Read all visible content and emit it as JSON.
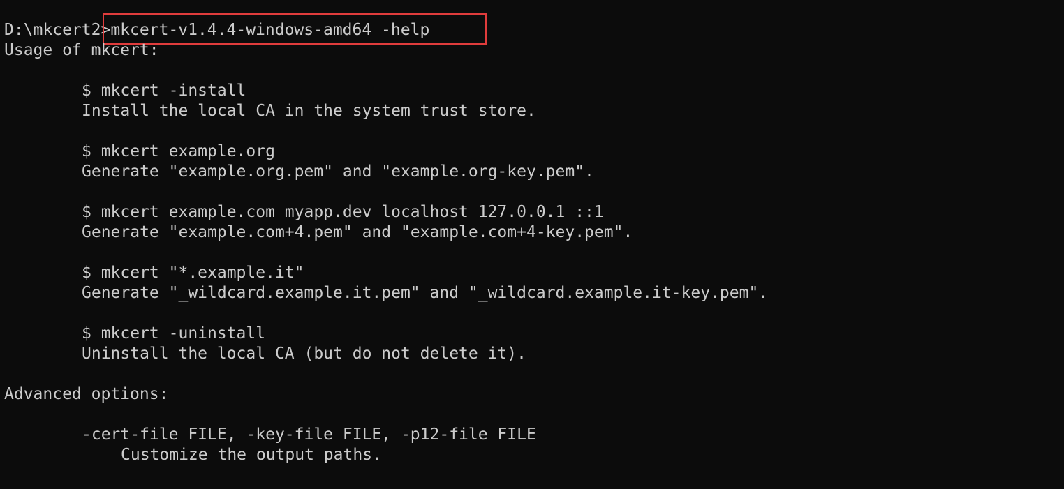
{
  "terminal": {
    "highlight_color": "#e03c3c",
    "background_color": "#0c0c0c",
    "text_color": "#cccccc",
    "prompt": "D:\\mkcert2>",
    "command": "mkcert-v1.4.4-windows-amd64 -help",
    "usage_header": "Usage of mkcert:",
    "examples": [
      {
        "cmd": "$ mkcert -install",
        "desc": "Install the local CA in the system trust store."
      },
      {
        "cmd": "$ mkcert example.org",
        "desc": "Generate \"example.org.pem\" and \"example.org-key.pem\"."
      },
      {
        "cmd": "$ mkcert example.com myapp.dev localhost 127.0.0.1 ::1",
        "desc": "Generate \"example.com+4.pem\" and \"example.com+4-key.pem\"."
      },
      {
        "cmd": "$ mkcert \"*.example.it\"",
        "desc": "Generate \"_wildcard.example.it.pem\" and \"_wildcard.example.it-key.pem\"."
      },
      {
        "cmd": "$ mkcert -uninstall",
        "desc": "Uninstall the local CA (but do not delete it)."
      }
    ],
    "advanced_header": "Advanced options:",
    "advanced_options": [
      {
        "flag": "-cert-file FILE, -key-file FILE, -p12-file FILE",
        "desc": "Customize the output paths."
      }
    ]
  }
}
